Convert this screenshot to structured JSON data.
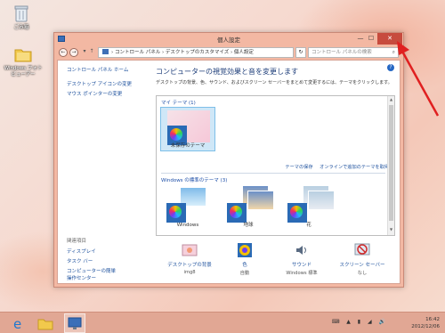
{
  "desktop": {
    "icons": [
      {
        "label": "ごみ箱"
      },
      {
        "label": "Windows フォトビューアー"
      }
    ]
  },
  "window": {
    "title": "個人設定",
    "controls": {
      "minimize": "—",
      "maximize": "☐",
      "close": "✕"
    },
    "nav": {
      "back": "←",
      "forward": "→",
      "recent": "▾",
      "up": "↑"
    },
    "breadcrumb": "› コントロール パネル › デスクトップのカスタマイズ › 個人設定",
    "refresh": "↻",
    "search_placeholder": "コントロール パネルの検索",
    "search_icon": "⌕"
  },
  "sidebar": {
    "home": "コントロール パネル ホーム",
    "items": [
      "デスクトップ アイコンの変更",
      "マウス ポインターの変更"
    ],
    "related_header": "関連項目",
    "related": [
      "ディスプレイ",
      "タスク バー",
      "コンピューターの簡単操作センター"
    ]
  },
  "main": {
    "heading": "コンピューターの視覚効果と音を変更します",
    "description": "デスクトップの背景、色、サウンド、およびスクリーン セーバーをまとめて変更するには、テーマをクリックします。",
    "help": "?",
    "my_themes_title": "マイ テーマ (1)",
    "unsaved_theme": "未保存のテーマ",
    "save_theme": "テーマの保存",
    "get_more_online": "オンラインで追加のテーマを取得",
    "standard_title": "Windows の標準のテーマ (3)",
    "standard_themes": [
      {
        "name": "Windows"
      },
      {
        "name": "地球"
      },
      {
        "name": "花"
      }
    ]
  },
  "bottom_bar": [
    {
      "label": "デスクトップの背景",
      "value": "img8"
    },
    {
      "label": "色",
      "value": "自動"
    },
    {
      "label": "サウンド",
      "value": "Windows 標準"
    },
    {
      "label": "スクリーン セーバー",
      "value": "なし"
    }
  ],
  "taskbar": {
    "time": "16:42",
    "date": "2012/12/06",
    "tray": "⌨ ▲ ▮ ◢ 🔊"
  },
  "colors": {
    "accent": "#f3b8a3",
    "close": "#c74b3e",
    "link": "#1b4f9c",
    "annotation": "#e02020"
  }
}
